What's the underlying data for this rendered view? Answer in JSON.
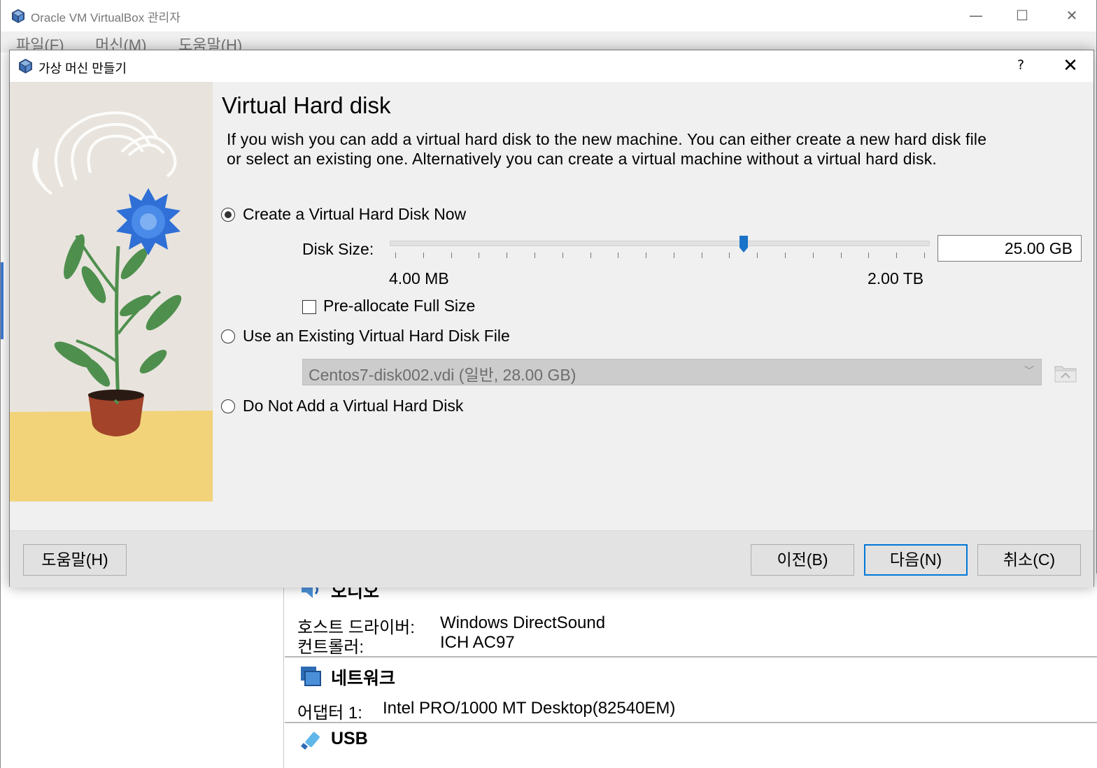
{
  "main_window": {
    "title": "Oracle VM VirtualBox 관리자",
    "controls": {
      "minimize": "—",
      "maximize": "☐",
      "close": "✕"
    },
    "menu": [
      "파일(F)",
      "머신(M)",
      "도움말(H)"
    ]
  },
  "details": {
    "audio": {
      "header": "오디오",
      "rows": [
        {
          "key": "호스트 드라이버:",
          "value": "Windows DirectSound"
        },
        {
          "key": "컨트롤러:",
          "value": "ICH AC97"
        }
      ]
    },
    "network": {
      "header": "네트워크",
      "rows": [
        {
          "key": "어댑터 1:",
          "value": "Intel PRO/1000 MT Desktop(82540EM)"
        }
      ]
    },
    "usb": {
      "header": "USB"
    }
  },
  "dialog": {
    "title": "가상 머신 만들기",
    "help_glyph": "?",
    "close_glyph": "✕",
    "heading": "Virtual Hard disk",
    "description": "If you wish you can add a virtual hard disk to the new machine. You can either create a new hard disk file or select an existing one. Alternatively you can create a virtual machine without a virtual hard disk.",
    "options": {
      "create_now": {
        "label": "Create a Virtual Hard Disk Now",
        "checked": true
      },
      "use_existing": {
        "label": "Use an Existing Virtual Hard Disk File",
        "checked": false
      },
      "do_not_add": {
        "label": "Do Not Add a Virtual Hard Disk",
        "checked": false
      }
    },
    "disk_size": {
      "label": "Disk Size:",
      "value": "25.00 GB",
      "min_label": "4.00 MB",
      "max_label": "2.00 TB",
      "slider_fraction": 0.655,
      "tick_count": 20
    },
    "preallocate": {
      "label": "Pre-allocate Full Size",
      "checked": false
    },
    "existing_file": {
      "selected": "Centos7-disk002.vdi (일반, 28.00 GB)",
      "arrow": "﹀"
    },
    "buttons": {
      "help": "도움말(H)",
      "back": "이전(B)",
      "next": "다음(N)",
      "cancel": "취소(C)"
    }
  },
  "colors": {
    "accent": "#0078d7",
    "slider_thumb": "#1a73c9",
    "disabled_field": "#cccccc",
    "art_sand": "#f2d37a",
    "art_leaf": "#4f8f4e",
    "art_flower": "#2f6fd6",
    "art_pot": "#a2432a"
  }
}
